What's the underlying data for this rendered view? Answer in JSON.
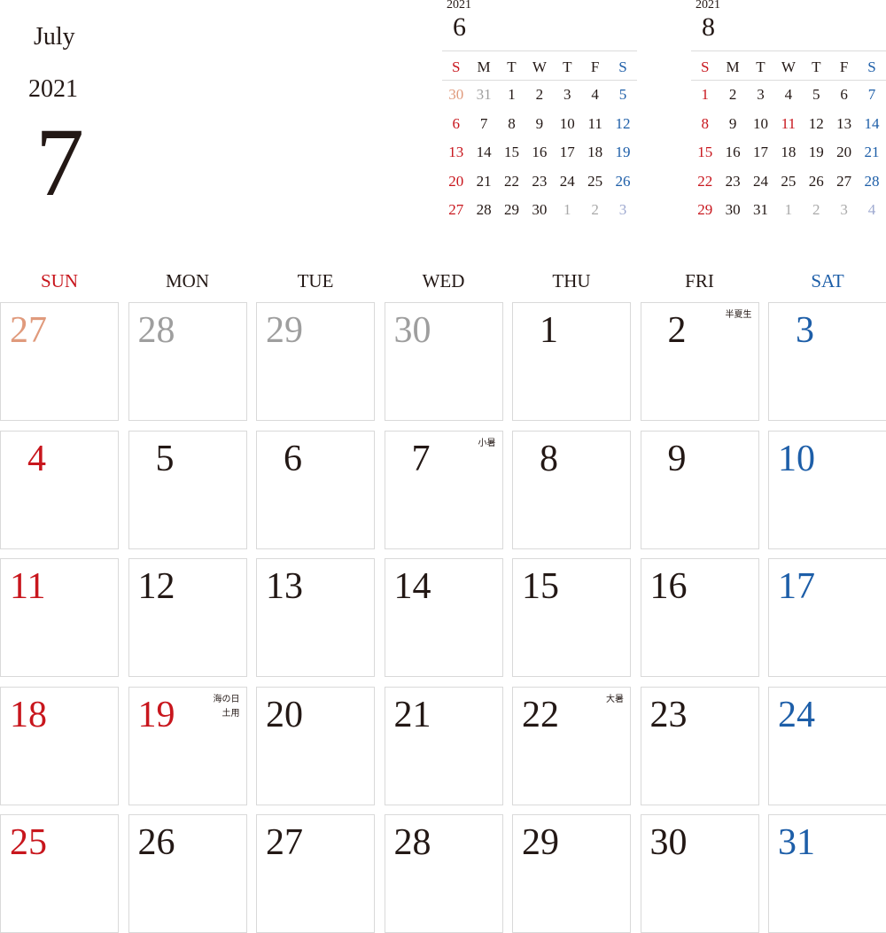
{
  "header": {
    "month_name": "July",
    "year": "2021",
    "month_number": "7"
  },
  "colors": {
    "sunday": "#c8161d",
    "saturday": "#1d5ea8",
    "weekday": "#231815",
    "other_month": "#9e9e9e",
    "other_month_sunday": "#e09a7c",
    "grid_border": "#d9d9d9"
  },
  "mini_calendars": [
    {
      "year": "2021",
      "month": "6",
      "weekdays": [
        "S",
        "M",
        "T",
        "W",
        "T",
        "F",
        "S"
      ],
      "weeks": [
        [
          {
            "d": "30",
            "t": "prev-sun"
          },
          {
            "d": "31",
            "t": "grey"
          },
          {
            "d": "1",
            "t": "black"
          },
          {
            "d": "2",
            "t": "black"
          },
          {
            "d": "3",
            "t": "black"
          },
          {
            "d": "4",
            "t": "black"
          },
          {
            "d": "5",
            "t": "sat"
          }
        ],
        [
          {
            "d": "6",
            "t": "sun"
          },
          {
            "d": "7",
            "t": "black"
          },
          {
            "d": "8",
            "t": "black"
          },
          {
            "d": "9",
            "t": "black"
          },
          {
            "d": "10",
            "t": "black"
          },
          {
            "d": "11",
            "t": "black"
          },
          {
            "d": "12",
            "t": "sat"
          }
        ],
        [
          {
            "d": "13",
            "t": "sun"
          },
          {
            "d": "14",
            "t": "black"
          },
          {
            "d": "15",
            "t": "black"
          },
          {
            "d": "16",
            "t": "black"
          },
          {
            "d": "17",
            "t": "black"
          },
          {
            "d": "18",
            "t": "black"
          },
          {
            "d": "19",
            "t": "sat"
          }
        ],
        [
          {
            "d": "20",
            "t": "sun"
          },
          {
            "d": "21",
            "t": "black"
          },
          {
            "d": "22",
            "t": "black"
          },
          {
            "d": "23",
            "t": "black"
          },
          {
            "d": "24",
            "t": "black"
          },
          {
            "d": "25",
            "t": "black"
          },
          {
            "d": "26",
            "t": "sat"
          }
        ],
        [
          {
            "d": "27",
            "t": "sun"
          },
          {
            "d": "28",
            "t": "black"
          },
          {
            "d": "29",
            "t": "black"
          },
          {
            "d": "30",
            "t": "black"
          },
          {
            "d": "1",
            "t": "grey-light"
          },
          {
            "d": "2",
            "t": "grey-light"
          },
          {
            "d": "3",
            "t": "sat-light"
          }
        ]
      ]
    },
    {
      "year": "2021",
      "month": "8",
      "weekdays": [
        "S",
        "M",
        "T",
        "W",
        "T",
        "F",
        "S"
      ],
      "weeks": [
        [
          {
            "d": "1",
            "t": "sun"
          },
          {
            "d": "2",
            "t": "black"
          },
          {
            "d": "3",
            "t": "black"
          },
          {
            "d": "4",
            "t": "black"
          },
          {
            "d": "5",
            "t": "black"
          },
          {
            "d": "6",
            "t": "black"
          },
          {
            "d": "7",
            "t": "sat"
          }
        ],
        [
          {
            "d": "8",
            "t": "sun"
          },
          {
            "d": "9",
            "t": "black"
          },
          {
            "d": "10",
            "t": "black"
          },
          {
            "d": "11",
            "t": "sun"
          },
          {
            "d": "12",
            "t": "black"
          },
          {
            "d": "13",
            "t": "black"
          },
          {
            "d": "14",
            "t": "sat"
          }
        ],
        [
          {
            "d": "15",
            "t": "sun"
          },
          {
            "d": "16",
            "t": "black"
          },
          {
            "d": "17",
            "t": "black"
          },
          {
            "d": "18",
            "t": "black"
          },
          {
            "d": "19",
            "t": "black"
          },
          {
            "d": "20",
            "t": "black"
          },
          {
            "d": "21",
            "t": "sat"
          }
        ],
        [
          {
            "d": "22",
            "t": "sun"
          },
          {
            "d": "23",
            "t": "black"
          },
          {
            "d": "24",
            "t": "black"
          },
          {
            "d": "25",
            "t": "black"
          },
          {
            "d": "26",
            "t": "black"
          },
          {
            "d": "27",
            "t": "black"
          },
          {
            "d": "28",
            "t": "sat"
          }
        ],
        [
          {
            "d": "29",
            "t": "sun"
          },
          {
            "d": "30",
            "t": "black"
          },
          {
            "d": "31",
            "t": "black"
          },
          {
            "d": "1",
            "t": "grey-light"
          },
          {
            "d": "2",
            "t": "grey-light"
          },
          {
            "d": "3",
            "t": "grey-light"
          },
          {
            "d": "4",
            "t": "sat-light"
          }
        ]
      ]
    }
  ],
  "main": {
    "weekdays": [
      "SUN",
      "MON",
      "TUE",
      "WED",
      "THU",
      "FRI",
      "SAT"
    ],
    "weeks": [
      [
        {
          "d": "27",
          "t": "prev-sun",
          "note": ""
        },
        {
          "d": "28",
          "t": "grey",
          "note": ""
        },
        {
          "d": "29",
          "t": "grey",
          "note": ""
        },
        {
          "d": "30",
          "t": "grey",
          "note": ""
        },
        {
          "d": "1",
          "t": "black",
          "note": ""
        },
        {
          "d": "2",
          "t": "black",
          "note": "半夏生"
        },
        {
          "d": "3",
          "t": "sat",
          "note": ""
        }
      ],
      [
        {
          "d": "4",
          "t": "sun",
          "note": ""
        },
        {
          "d": "5",
          "t": "black",
          "note": ""
        },
        {
          "d": "6",
          "t": "black",
          "note": ""
        },
        {
          "d": "7",
          "t": "black",
          "note": "小暑"
        },
        {
          "d": "8",
          "t": "black",
          "note": ""
        },
        {
          "d": "9",
          "t": "black",
          "note": ""
        },
        {
          "d": "10",
          "t": "sat",
          "note": ""
        }
      ],
      [
        {
          "d": "11",
          "t": "sun",
          "note": ""
        },
        {
          "d": "12",
          "t": "black",
          "note": ""
        },
        {
          "d": "13",
          "t": "black",
          "note": ""
        },
        {
          "d": "14",
          "t": "black",
          "note": ""
        },
        {
          "d": "15",
          "t": "black",
          "note": ""
        },
        {
          "d": "16",
          "t": "black",
          "note": ""
        },
        {
          "d": "17",
          "t": "sat",
          "note": ""
        }
      ],
      [
        {
          "d": "18",
          "t": "sun",
          "note": ""
        },
        {
          "d": "19",
          "t": "sun",
          "note": "海の日\n土用"
        },
        {
          "d": "20",
          "t": "black",
          "note": ""
        },
        {
          "d": "21",
          "t": "black",
          "note": ""
        },
        {
          "d": "22",
          "t": "black",
          "note": "大暑"
        },
        {
          "d": "23",
          "t": "black",
          "note": ""
        },
        {
          "d": "24",
          "t": "sat",
          "note": ""
        }
      ],
      [
        {
          "d": "25",
          "t": "sun",
          "note": ""
        },
        {
          "d": "26",
          "t": "black",
          "note": ""
        },
        {
          "d": "27",
          "t": "black",
          "note": ""
        },
        {
          "d": "28",
          "t": "black",
          "note": ""
        },
        {
          "d": "29",
          "t": "black",
          "note": ""
        },
        {
          "d": "30",
          "t": "black",
          "note": ""
        },
        {
          "d": "31",
          "t": "sat",
          "note": ""
        }
      ]
    ]
  }
}
